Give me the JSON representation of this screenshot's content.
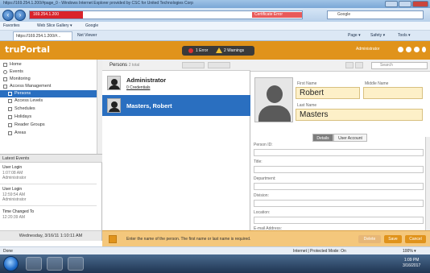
{
  "browser": {
    "window_title": "https://169.254.1.200/#page_0 - Windows Internet Explorer provided by CSC for United Technologies Corp",
    "address": "169.254.1.200",
    "cert_error": "Certificate Error",
    "search_placeholder": "Google",
    "favorites_label": "Favorites",
    "fav_links": [
      "Web Slice Gallery ▾",
      "Google"
    ],
    "tab_label": "https://169.254.1.200/#...",
    "tab2_label": "Net Viewer",
    "commands": [
      "Page ▾",
      "Safety ▾",
      "Tools ▾"
    ]
  },
  "app": {
    "logo": "truPortal",
    "errors": "1 Error",
    "warnings": "2 Warnings",
    "user": "Administrator"
  },
  "sidebar": {
    "items": [
      {
        "label": "Home"
      },
      {
        "label": "Events"
      },
      {
        "label": "Monitoring"
      },
      {
        "label": "Access Management"
      },
      {
        "label": "Persons"
      },
      {
        "label": "Access Levels"
      },
      {
        "label": "Schedules"
      },
      {
        "label": "Holidays"
      },
      {
        "label": "Reader Groups"
      },
      {
        "label": "Areas"
      }
    ]
  },
  "events": {
    "title": "Latest Events",
    "items": [
      {
        "name": "User Login",
        "time": "1:07:08 AM",
        "who": "Administrator"
      },
      {
        "name": "User Login",
        "time": "12:59:54 AM",
        "who": "Administrator"
      },
      {
        "name": "Time Changed To",
        "time": "12:20:39 AM",
        "who": ""
      }
    ],
    "footer_date": "Wednesday, 3/16/11 1:10:11 AM"
  },
  "persons": {
    "title": "Persons",
    "count": "2 total",
    "rows": [
      {
        "name": "Administrator",
        "sub": "0 Credentials"
      },
      {
        "name": "Masters, Robert",
        "sub": ""
      }
    ]
  },
  "detail": {
    "search_placeholder": "Search",
    "first_name_label": "First Name",
    "first_name": "Robert",
    "middle_name_label": "Middle Name",
    "middle_name": "",
    "last_name_label": "Last Name",
    "last_name": "Masters",
    "tabs": [
      "Details",
      "User Account"
    ],
    "fields": [
      "Person ID:",
      "Title:",
      "Department:",
      "Division:",
      "Location:",
      "E-mail Address:"
    ]
  },
  "bottom": {
    "message": "Enter the name of the person. The first name or last name is required.",
    "buttons": [
      "Delete",
      "Save",
      "Cancel"
    ]
  },
  "status": {
    "left": "Done",
    "zone": "Internet | Protected Mode: On",
    "zoom": "100% ▾"
  },
  "clock": {
    "time": "1:09 PM",
    "date": "3/16/2017"
  },
  "colors": {
    "accent": "#e0931b",
    "selection": "#2a6fc0",
    "input_bg": "#fdf0c8"
  }
}
